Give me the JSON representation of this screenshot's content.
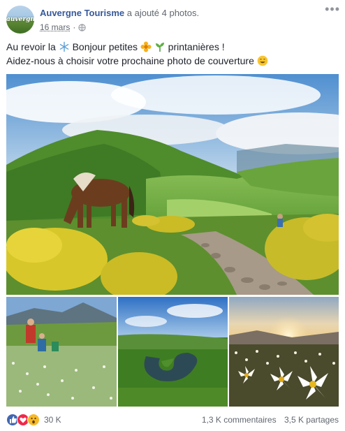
{
  "post": {
    "page_name": "Auvergne Tourisme",
    "action": "a ajouté 4 photos.",
    "date": "16 mars",
    "avatar_text": "auvergne",
    "more_icon": "more-dots-icon",
    "privacy_icon": "globe-icon"
  },
  "message": {
    "line1_part1": "Au revoir la",
    "line1_part2": "Bonjour petites",
    "line1_part3": "printanières !",
    "line2": "Aidez-nous à choisir votre prochaine photo de couverture",
    "emojis": [
      "snowflake-icon",
      "flower-icon",
      "herb-icon",
      "smile-icon"
    ]
  },
  "photos": [
    {
      "name": "horse-mountain-valley-photo"
    },
    {
      "name": "hikers-flower-meadow-photo"
    },
    {
      "name": "river-meander-photo"
    },
    {
      "name": "daffodils-sunset-photo"
    }
  ],
  "footer": {
    "reactions_count": "30 K",
    "comments": "1,3 K commentaires",
    "shares": "3,5 K partages",
    "reaction_icons": [
      "like-icon",
      "love-icon",
      "wow-icon"
    ]
  },
  "colors": {
    "link_blue": "#365899",
    "muted": "#616770",
    "like": "#4267b2",
    "love": "#f0284a",
    "wow": "#f7b928"
  }
}
